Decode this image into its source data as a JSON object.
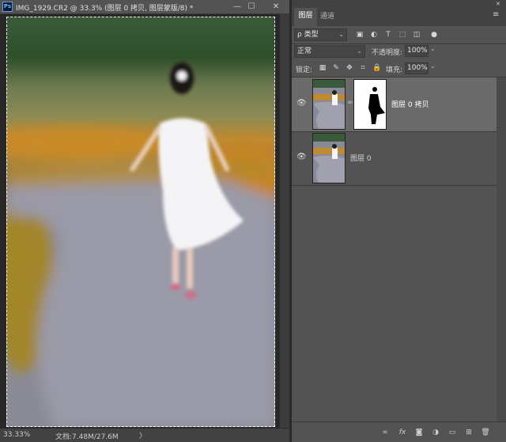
{
  "document": {
    "title": "IMG_1929.CR2 @ 33.3% (图层 0 拷贝, 图层蒙版/8) *",
    "logo": "Ps",
    "zoom": "33.33%",
    "doc_size": "文档:7.48M/27.6M",
    "status_arrow": "〉"
  },
  "window": {
    "minimize": "—",
    "maximize": "☐",
    "close": "✕"
  },
  "panel": {
    "tabs": [
      {
        "label": "图层"
      },
      {
        "label": "通道"
      }
    ],
    "menu_icon": "≡",
    "close_icon": "✕",
    "filter": {
      "label": "ρ 类型"
    },
    "blend_mode": "正常",
    "opacity_label": "不透明度:",
    "opacity_value": "100%",
    "lock_label": "锁定:",
    "fill_label": "填充:",
    "fill_value": "100%",
    "layers": [
      {
        "name": "图层 0 拷贝",
        "visible": true,
        "selected": true,
        "has_mask": true
      },
      {
        "name": "图层 0",
        "visible": true,
        "selected": false,
        "has_mask": false
      }
    ]
  },
  "colors": {
    "selected_layer": "#6a6a6a",
    "panel_bg": "#535353",
    "accent": "#5aa0e0"
  }
}
